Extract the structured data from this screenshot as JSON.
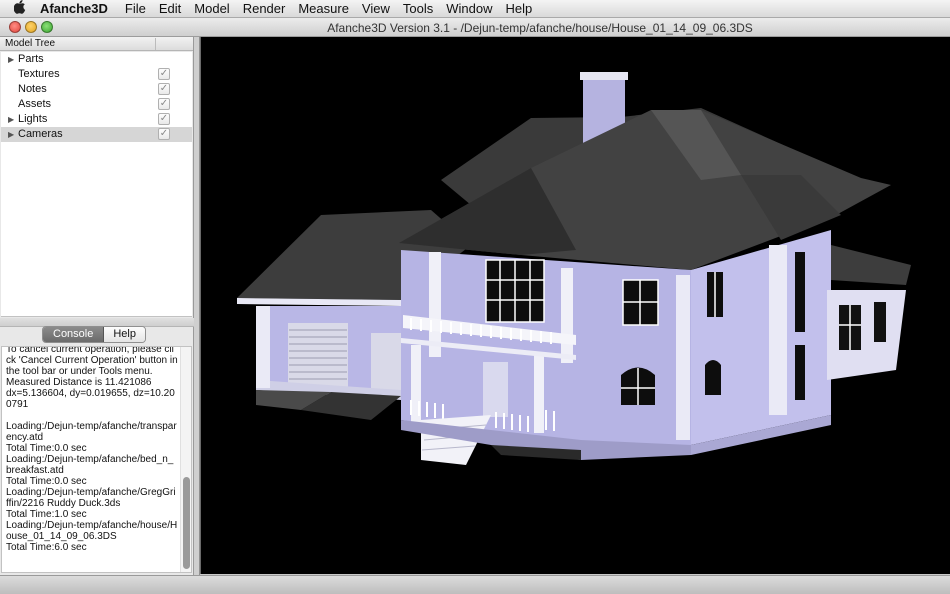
{
  "menubar": {
    "app_name": "Afanche3D",
    "items": [
      "File",
      "Edit",
      "Model",
      "Render",
      "Measure",
      "View",
      "Tools",
      "Window",
      "Help"
    ]
  },
  "window": {
    "title": "Afanche3D Version 3.1 - /Dejun-temp/afanche/house/House_01_14_09_06.3DS"
  },
  "model_tree": {
    "header": "Model Tree",
    "items": [
      {
        "label": "Parts",
        "expandable": true,
        "checked": false
      },
      {
        "label": "Textures",
        "expandable": false,
        "checked": true
      },
      {
        "label": "Notes",
        "expandable": false,
        "checked": true
      },
      {
        "label": "Assets",
        "expandable": false,
        "checked": true
      },
      {
        "label": "Lights",
        "expandable": true,
        "checked": true
      },
      {
        "label": "Cameras",
        "expandable": true,
        "checked": true,
        "selected": true
      }
    ]
  },
  "tabs": {
    "console": "Console",
    "help": "Help"
  },
  "console": {
    "text": "To cancel current operation, please click 'Cancel Current Operation' button in the tool bar or under Tools menu.\nMeasured Distance is 11.421086\ndx=5.136604, dy=0.019655, dz=10.200791\n\nLoading:/Dejun-temp/afanche/transparency.atd\nTotal Time:0.0 sec\nLoading:/Dejun-temp/afanche/bed_n_breakfast.atd\nTotal Time:0.0 sec\nLoading:/Dejun-temp/afanche/GregGriffin/2216 Ruddy Duck.3ds\nTotal Time:1.0 sec\nLoading:/Dejun-temp/afanche/house/House_01_14_09_06.3DS\nTotal Time:6.0 sec"
  },
  "icons": {
    "apple": "apple-logo-icon",
    "expand": "disclosure-triangle-icon",
    "check": "checkmark-icon"
  },
  "colors": {
    "viewport_bg": "#000000",
    "wall": "#b7b5e6",
    "roof": "#4a4a4a",
    "trim": "#ffffff"
  }
}
